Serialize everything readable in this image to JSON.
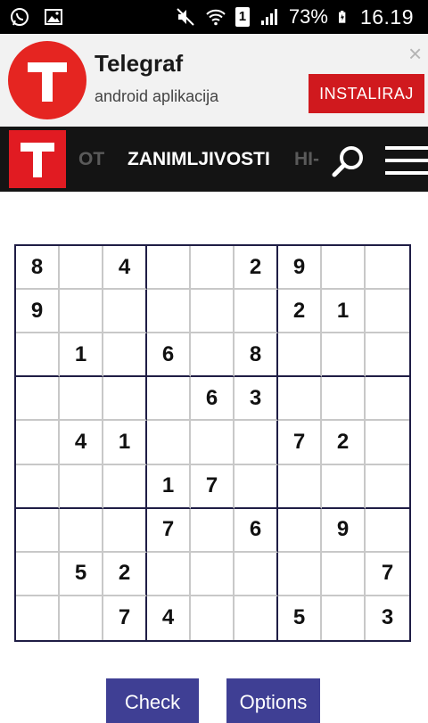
{
  "status_bar": {
    "battery_percent": "73%",
    "time": "16.19",
    "sim_slot": "1"
  },
  "ad": {
    "title": "Telegraf",
    "subtitle": "android aplikacija",
    "install_label": "INSTALIRAJ",
    "close_glyph": "×"
  },
  "nav": {
    "items": [
      "OT",
      "ZANIMLJIVOSTI",
      "HI-"
    ]
  },
  "sudoku": {
    "rows": [
      [
        "8",
        "",
        "4",
        "",
        "",
        "2",
        "9",
        "",
        ""
      ],
      [
        "9",
        "",
        "",
        "",
        "",
        "",
        "2",
        "1",
        ""
      ],
      [
        "",
        "1",
        "",
        "6",
        "",
        "8",
        "",
        "",
        ""
      ],
      [
        "",
        "",
        "",
        "",
        "6",
        "3",
        "",
        "",
        ""
      ],
      [
        "",
        "4",
        "1",
        "",
        "",
        "",
        "7",
        "2",
        ""
      ],
      [
        "",
        "",
        "",
        "1",
        "7",
        "",
        "",
        "",
        ""
      ],
      [
        "",
        "",
        "",
        "7",
        "",
        "6",
        "",
        "9",
        ""
      ],
      [
        "",
        "5",
        "2",
        "",
        "",
        "",
        "",
        "",
        "7"
      ],
      [
        "",
        "",
        "7",
        "4",
        "",
        "",
        "5",
        "",
        "3"
      ]
    ]
  },
  "buttons": {
    "check_label": "Check",
    "options_label": "Options"
  },
  "colors": {
    "brand_red": "#e11b22",
    "install_red": "#d0191e",
    "button_blue": "#3f3f94",
    "grid_line_dark": "#1f1d45",
    "grid_line_light": "#c8c8c8"
  },
  "icons": [
    "whatsapp-icon",
    "image-icon",
    "mute-icon",
    "wifi-icon",
    "signal-icon",
    "battery-charging-icon",
    "telegraf-logo",
    "search-icon",
    "menu-icon",
    "close-icon"
  ]
}
